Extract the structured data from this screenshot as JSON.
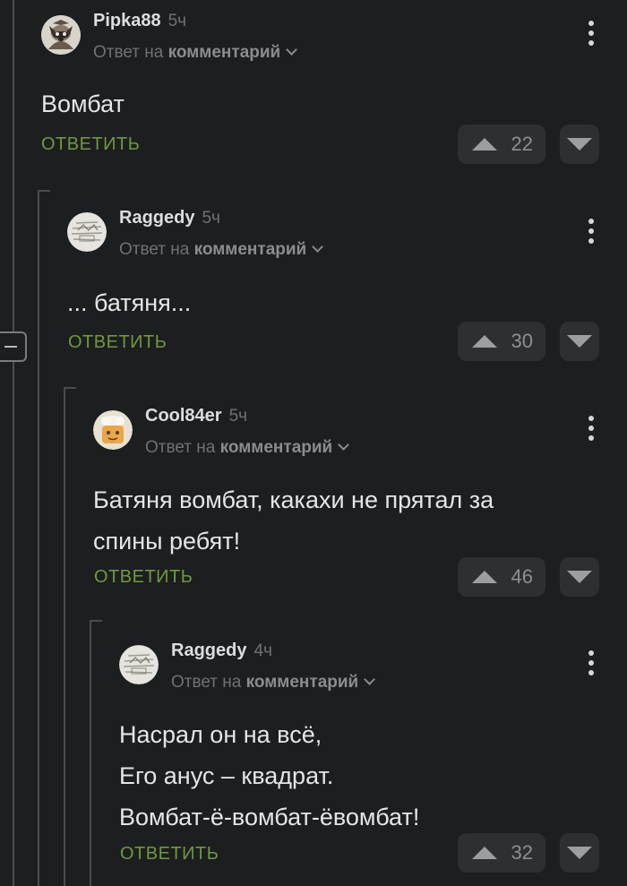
{
  "comments": [
    {
      "username": "Pipka88",
      "time": "5ч",
      "reply_prefix": "Ответ на",
      "reply_target": "комментарий",
      "body": "Вомбат",
      "reply_label": "ОТВЕТИТЬ",
      "rating": "22",
      "avatar": "raccoon-avatar"
    },
    {
      "username": "Raggedy",
      "time": "5ч",
      "reply_prefix": "Ответ на",
      "reply_target": "комментарий",
      "body": "... батяня...",
      "reply_label": "ОТВЕТИТЬ",
      "rating": "30",
      "avatar": "sketch-avatar"
    },
    {
      "username": "Cool84er",
      "time": "5ч",
      "reply_prefix": "Ответ на",
      "reply_target": "комментарий",
      "body": "Батяня вомбат, какахи не прятал за\nспины ребят!",
      "reply_label": "ОТВЕТИТЬ",
      "rating": "46",
      "avatar": "chef-avatar"
    },
    {
      "username": "Raggedy",
      "time": "4ч",
      "reply_prefix": "Ответ на",
      "reply_target": "комментарий",
      "body": "Насрал он на всё,\nЕго анус – квадрат.\nВомбат-ё-вомбат-ёвомбат!",
      "reply_label": "ОТВЕТИТЬ",
      "rating": "32",
      "avatar": "sketch-avatar"
    }
  ],
  "colors": {
    "background": "#1d1e20",
    "reply_link": "#6e9a3c",
    "vote_button": "#2d2f32",
    "muted_text": "#6f7175"
  }
}
